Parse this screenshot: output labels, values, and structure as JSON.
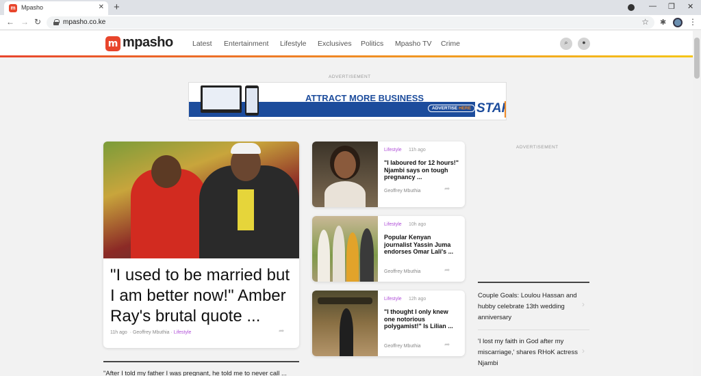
{
  "browser": {
    "tab_title": "Mpasho",
    "tab_favicon_letter": "m",
    "url": "mpasho.co.ke"
  },
  "site": {
    "logo_mark": "m",
    "logo_text": "mpasho",
    "nav": [
      "Latest",
      "Entertainment",
      "Lifestyle",
      "Exclusives",
      "Politics",
      "Mpasho TV",
      "Crime"
    ],
    "brand_colors": {
      "primary": "#e8452c",
      "accent": "#f5c518",
      "category": "#b04fd8"
    }
  },
  "ads": {
    "label": "ADVERTISEMENT",
    "banner_headline": "ATTRACT MORE BUSINESS",
    "banner_cta_prefix": "ADVERTISE",
    "banner_cta_suffix": "HERE",
    "banner_brand": "STAR"
  },
  "feature": {
    "title": "\"I used to be married but I am better now!\" Amber Ray's brutal quote ...",
    "time": "11h ago",
    "author": "· Geoffrey Mbuthia ·",
    "category": "Lifestyle"
  },
  "cards": [
    {
      "category": "Lifestyle",
      "time": "11h ago",
      "title": "\"I laboured for 12 hours!\" Njambi says on tough pregnancy ...",
      "author": "Geoffrey Mbuthia"
    },
    {
      "category": "Lifestyle",
      "time": "10h ago",
      "title": "Popular Kenyan journalist Yassin Juma endorses Omar Lali's ...",
      "author": "Geoffrey Mbuthia"
    },
    {
      "category": "Lifestyle",
      "time": "12h ago",
      "title": "\"I thought I only knew one notorious polygamist!\" Is Lilian ...",
      "author": "Geoffrey Mbuthia"
    }
  ],
  "right_column": [
    "Couple Goals: Loulou Hassan and hubby celebrate 13th wedding anniversary",
    "'I lost my faith in God after my miscarriage,' shares RHoK actress Njambi"
  ],
  "bottom_teaser": "\"After I told my father I was pregnant, he told me to never call ..."
}
